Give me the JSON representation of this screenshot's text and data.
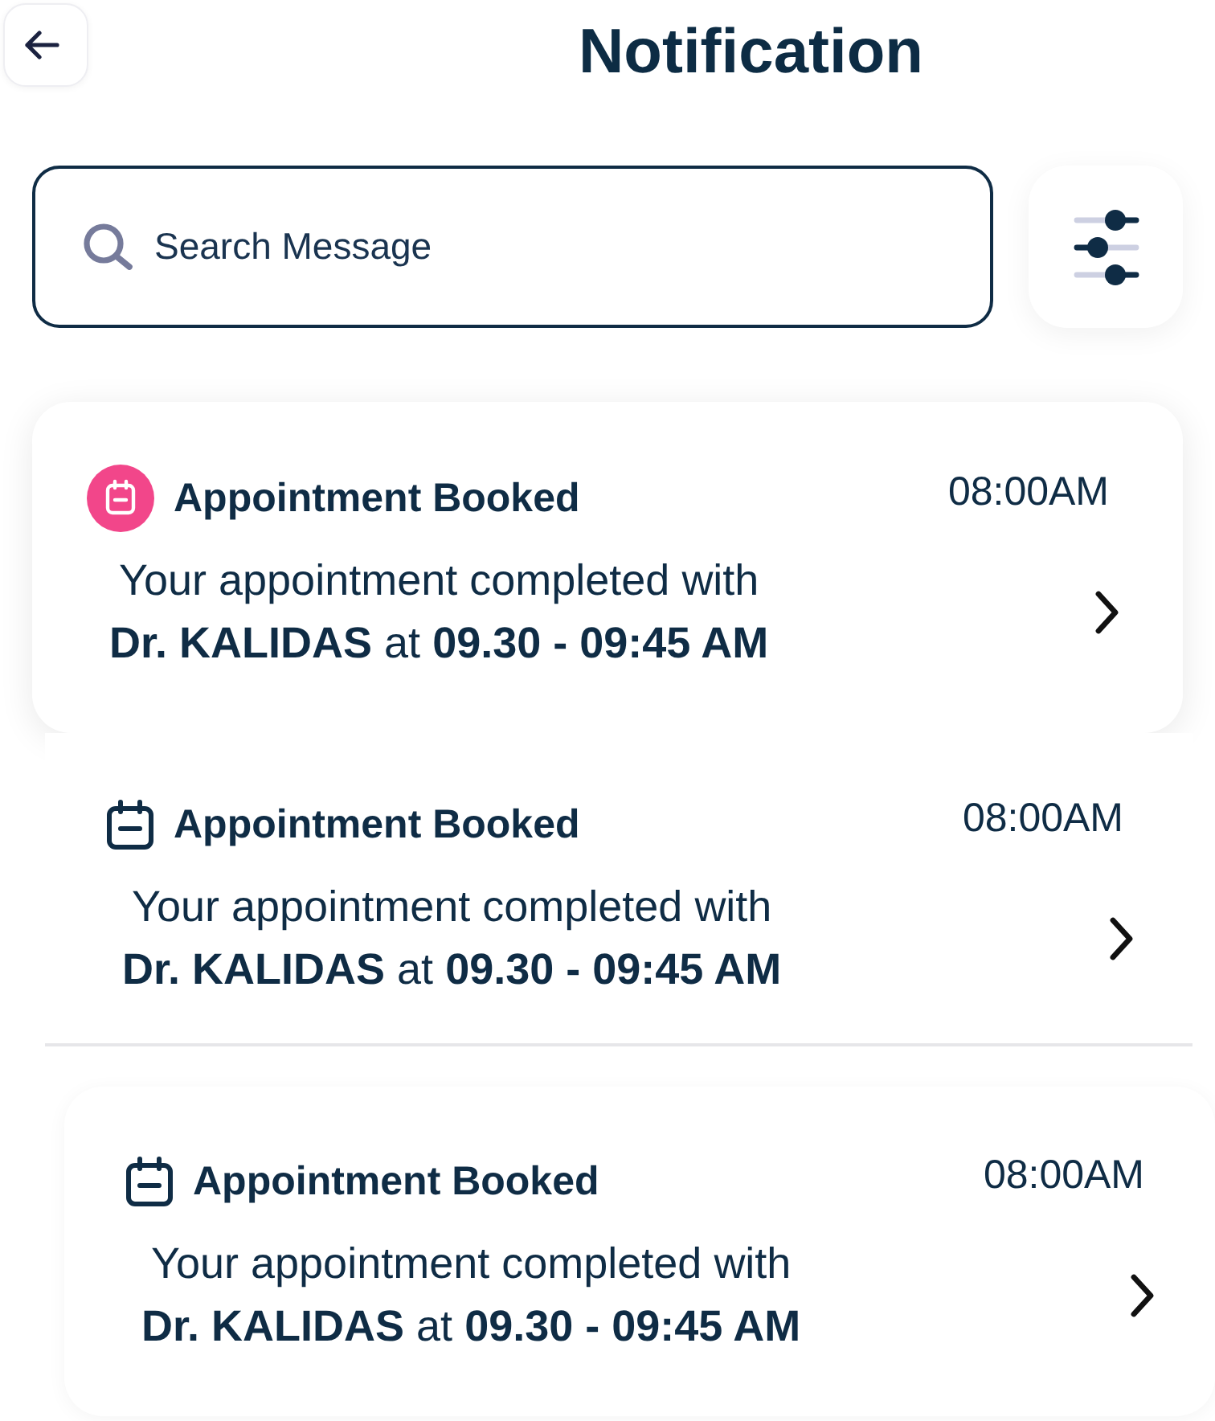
{
  "title": "Notification",
  "search": {
    "placeholder": "Search Message"
  },
  "notifications": [
    {
      "kind": "card",
      "unread": true,
      "title": "Appointment Booked",
      "time": "08:00AM",
      "message": "Your appointment completed with\n**Dr. KALIDAS** at **09.30 - 09:45 AM**"
    },
    {
      "kind": "row",
      "unread": false,
      "title": "Appointment Booked",
      "time": "08:00AM",
      "message": "Your appointment completed with\n**Dr. KALIDAS** at **09.30 - 09:45 AM**"
    },
    {
      "kind": "card",
      "unread": false,
      "title": "Appointment Booked",
      "time": "08:00AM",
      "message": "Your appointment completed with\n**Dr. KALIDAS** at **09.30 - 09:45 AM**"
    }
  ]
}
